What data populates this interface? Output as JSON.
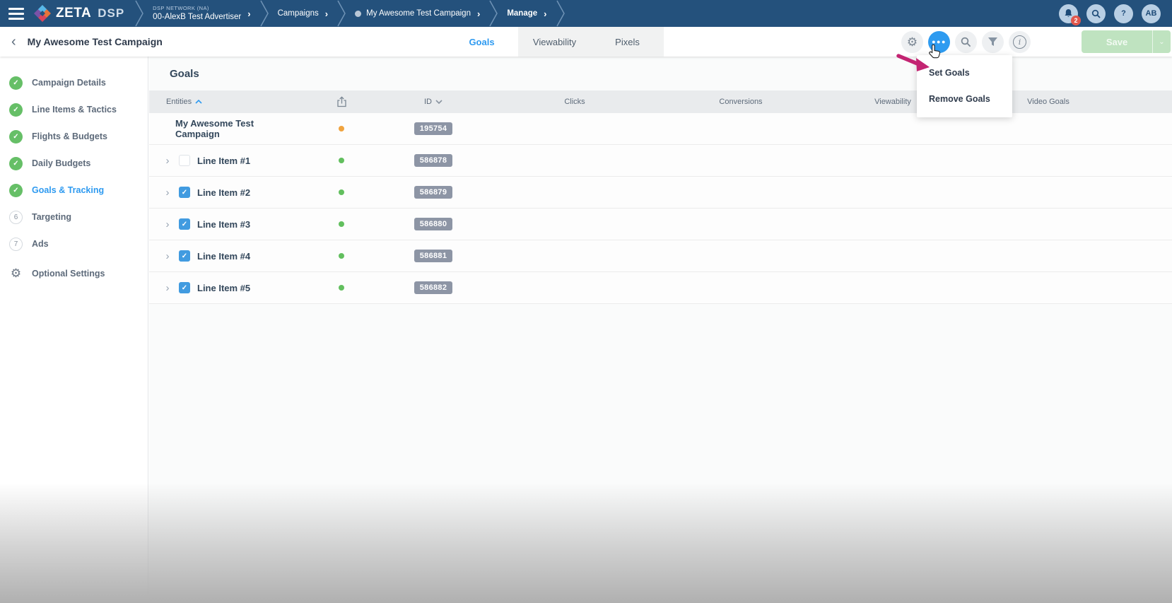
{
  "topbar": {
    "logo": {
      "brand": "ZETA",
      "suffix": "DSP"
    },
    "breadcrumbs": [
      {
        "eyebrow": "DSP NETWORK (NA)",
        "label": "00-AlexB Test Advertiser"
      },
      {
        "label": "Campaigns"
      },
      {
        "label": "My Awesome Test Campaign",
        "dot": true
      },
      {
        "label": "Manage",
        "bold": true
      }
    ],
    "notifications_count": "2",
    "help_glyph": "?",
    "avatar_initials": "AB"
  },
  "header": {
    "title": "My Awesome Test Campaign",
    "tabs": [
      {
        "label": "Goals",
        "active": true
      },
      {
        "label": "Viewability",
        "active": false
      },
      {
        "label": "Pixels",
        "active": false
      }
    ],
    "save_label": "Save"
  },
  "menu": {
    "items": [
      {
        "label": "Set Goals"
      },
      {
        "label": "Remove Goals"
      }
    ]
  },
  "sidebar": {
    "items": [
      {
        "label": "Campaign Details",
        "state": "complete"
      },
      {
        "label": "Line Items & Tactics",
        "state": "complete"
      },
      {
        "label": "Flights & Budgets",
        "state": "complete"
      },
      {
        "label": "Daily Budgets",
        "state": "complete"
      },
      {
        "label": "Goals & Tracking",
        "state": "complete",
        "active": true
      },
      {
        "label": "Targeting",
        "state": "number",
        "number": "6"
      },
      {
        "label": "Ads",
        "state": "number",
        "number": "7"
      },
      {
        "label": "Optional Settings",
        "state": "gear"
      }
    ]
  },
  "main": {
    "section_title": "Goals",
    "columns": {
      "entities": "Entities",
      "id": "ID",
      "clicks": "Clicks",
      "conversions": "Conversions",
      "viewability": "Viewability",
      "video_goals": "Video Goals"
    },
    "rows": [
      {
        "name": "My Awesome Test Campaign",
        "id": "195754",
        "status": "orange",
        "type": "campaign"
      },
      {
        "name": "Line Item #1",
        "id": "586878",
        "status": "green",
        "type": "line",
        "checked": false
      },
      {
        "name": "Line Item #2",
        "id": "586879",
        "status": "green",
        "type": "line",
        "checked": true
      },
      {
        "name": "Line Item #3",
        "id": "586880",
        "status": "green",
        "type": "line",
        "checked": true
      },
      {
        "name": "Line Item #4",
        "id": "586881",
        "status": "green",
        "type": "line",
        "checked": true
      },
      {
        "name": "Line Item #5",
        "id": "586882",
        "status": "green",
        "type": "line",
        "checked": true
      }
    ]
  },
  "colors": {
    "topbar_bg": "#24517c",
    "accent_blue": "#2e9af0",
    "complete_green": "#66bf67",
    "status_green": "#62bf5e",
    "status_orange": "#f0a33f",
    "badge_gray": "#8d95a5",
    "annotation_magenta": "#c32472",
    "save_green": "#bfe3c0",
    "notification_red": "#e2574c"
  }
}
